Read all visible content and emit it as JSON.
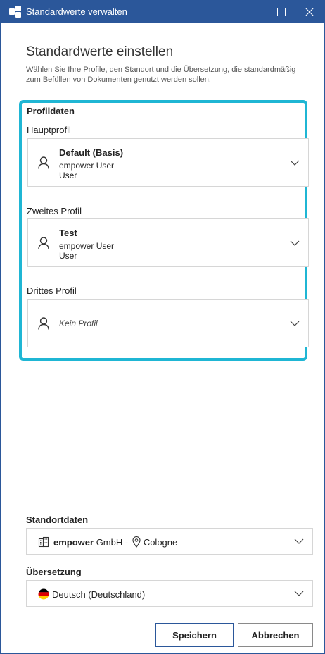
{
  "window": {
    "title": "Standardwerte verwalten"
  },
  "heading": "Standardwerte einstellen",
  "description": "Wählen Sie Ihre Profile, den Standort und die Übersetzung, die standardmäßig zum Befüllen von Dokumenten genutzt werden sollen.",
  "profile_section": {
    "title": "Profildaten",
    "main": {
      "label": "Hauptprofil",
      "name": "Default (Basis)",
      "line2": "empower User",
      "line3": "User"
    },
    "second": {
      "label": "Zweites Profil",
      "name": "Test",
      "line2": "empower User",
      "line3": "User"
    },
    "third": {
      "label": "Drittes Profil",
      "empty_text": "Kein Profil"
    }
  },
  "location": {
    "label": "Standortdaten",
    "company_bold": "empower",
    "company_rest": " GmbH - ",
    "city": "Cologne"
  },
  "translation": {
    "label": "Übersetzung",
    "value": "Deutsch (Deutschland)"
  },
  "buttons": {
    "save": "Speichern",
    "cancel": "Abbrechen"
  },
  "colors": {
    "titlebar": "#2b579a",
    "highlight_border": "#1fb6d4"
  }
}
